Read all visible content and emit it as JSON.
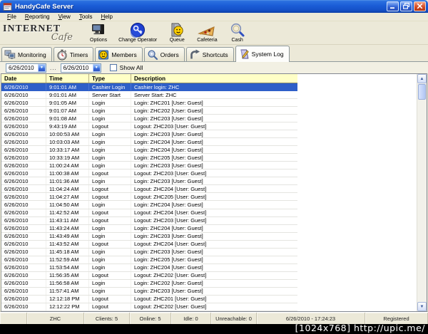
{
  "window": {
    "title": "HandyCafe Server",
    "app_icon": "app-icon",
    "controls": [
      {
        "name": "minimize-button",
        "icon": "minimize-icon"
      },
      {
        "name": "restore-button",
        "icon": "restore-icon"
      },
      {
        "name": "close-button",
        "icon": "close-icon"
      }
    ]
  },
  "menu": {
    "items": [
      "File",
      "Reporting",
      "View",
      "Tools",
      "Help"
    ]
  },
  "toolbar": {
    "logo": {
      "line1": "INTERNET",
      "line2": "Cafe"
    },
    "buttons": [
      {
        "label": "Options",
        "icon": "options-icon"
      },
      {
        "label": "Change Operator",
        "icon": "change-operator-icon"
      },
      {
        "label": "Queue",
        "icon": "queue-icon"
      },
      {
        "label": "Cafeteria",
        "icon": "cafeteria-icon"
      },
      {
        "label": "Cash",
        "icon": "cash-icon"
      }
    ]
  },
  "tabs": [
    {
      "label": "Monitoring",
      "icon": "monitoring-icon",
      "active": false
    },
    {
      "label": "Timers",
      "icon": "timers-icon",
      "active": false
    },
    {
      "label": "Members",
      "icon": "members-icon",
      "active": false
    },
    {
      "label": "Orders",
      "icon": "orders-icon",
      "active": false
    },
    {
      "label": "Shortcuts",
      "icon": "shortcuts-icon",
      "active": false
    },
    {
      "label": "System Log",
      "icon": "system-log-icon",
      "active": true
    }
  ],
  "filters": {
    "date_from": "6/26/2010",
    "range_separator": "...",
    "date_to": "6/26/2010",
    "show_all_label": "Show All",
    "show_all_checked": false
  },
  "log_table": {
    "columns": [
      "Date",
      "Time",
      "Type",
      "Description"
    ],
    "selected_row_index": 0,
    "rows": [
      [
        "6/26/2010",
        "9:01:01 AM",
        "Cashier Login",
        "Cashier login: ZHC"
      ],
      [
        "6/26/2010",
        "9:01:01 AM",
        "Server Start",
        "Server Start: ZHC"
      ],
      [
        "6/26/2010",
        "9:01:05 AM",
        "Login",
        "Login: ZHC201 [User: Guest]"
      ],
      [
        "6/26/2010",
        "9:01:07 AM",
        "Login",
        "Login: ZHC202 [User: Guest]"
      ],
      [
        "6/26/2010",
        "9:01:08 AM",
        "Login",
        "Login: ZHC203 [User: Guest]"
      ],
      [
        "6/26/2010",
        "9:43:19 AM",
        "Logout",
        "Logout: ZHC203 [User: Guest]"
      ],
      [
        "6/26/2010",
        "10:00:53 AM",
        "Login",
        "Login: ZHC203 [User: Guest]"
      ],
      [
        "6/26/2010",
        "10:03:03 AM",
        "Login",
        "Login: ZHC204 [User: Guest]"
      ],
      [
        "6/26/2010",
        "10:33:17 AM",
        "Login",
        "Login: ZHC204 [User: Guest]"
      ],
      [
        "6/26/2010",
        "10:33:19 AM",
        "Login",
        "Login: ZHC205 [User: Guest]"
      ],
      [
        "6/26/2010",
        "11:00:24 AM",
        "Login",
        "Login: ZHC203 [User: Guest]"
      ],
      [
        "6/26/2010",
        "11:00:38 AM",
        "Logout",
        "Logout: ZHC203 [User: Guest]"
      ],
      [
        "6/26/2010",
        "11:01:36 AM",
        "Login",
        "Login: ZHC203 [User: Guest]"
      ],
      [
        "6/26/2010",
        "11:04:24 AM",
        "Logout",
        "Logout: ZHC204 [User: Guest]"
      ],
      [
        "6/26/2010",
        "11:04:27 AM",
        "Logout",
        "Logout: ZHC205 [User: Guest]"
      ],
      [
        "6/26/2010",
        "11:04:50 AM",
        "Login",
        "Login: ZHC204 [User: Guest]"
      ],
      [
        "6/26/2010",
        "11:42:52 AM",
        "Logout",
        "Logout: ZHC204 [User: Guest]"
      ],
      [
        "6/26/2010",
        "11:43:11 AM",
        "Logout",
        "Logout: ZHC203 [User: Guest]"
      ],
      [
        "6/26/2010",
        "11:43:24 AM",
        "Login",
        "Login: ZHC204 [User: Guest]"
      ],
      [
        "6/26/2010",
        "11:43:49 AM",
        "Login",
        "Login: ZHC203 [User: Guest]"
      ],
      [
        "6/26/2010",
        "11:43:52 AM",
        "Logout",
        "Logout: ZHC204 [User: Guest]"
      ],
      [
        "6/26/2010",
        "11:45:18 AM",
        "Login",
        "Login: ZHC203 [User: Guest]"
      ],
      [
        "6/26/2010",
        "11:52:59 AM",
        "Login",
        "Login: ZHC205 [User: Guest]"
      ],
      [
        "6/26/2010",
        "11:53:54 AM",
        "Login",
        "Login: ZHC204 [User: Guest]"
      ],
      [
        "6/26/2010",
        "11:56:35 AM",
        "Logout",
        "Logout: ZHC202 [User: Guest]"
      ],
      [
        "6/26/2010",
        "11:56:58 AM",
        "Login",
        "Login: ZHC202 [User: Guest]"
      ],
      [
        "6/26/2010",
        "11:57:41 AM",
        "Login",
        "Login: ZHC203 [User: Guest]"
      ],
      [
        "6/26/2010",
        "12:12:18 PM",
        "Logout",
        "Logout: ZHC201 [User: Guest]"
      ],
      [
        "6/26/2010",
        "12:12:22 PM",
        "Logout",
        "Logout: ZHC202 [User: Guest]"
      ]
    ]
  },
  "status_bar": {
    "panels": [
      "",
      "ZHC",
      "Clients: 5",
      "Online: 5",
      "Idle: 0",
      "Unreachable: 0",
      "6/26/2010 - 17:24:23",
      "Registered"
    ]
  },
  "watermark": "[1024x768] http://upic.me/",
  "colors": {
    "titlebar_blue": "#1b5cd6",
    "selection_blue": "#2e5fc8",
    "header_yellow": "#ffffc6",
    "chrome_beige": "#ece9d8",
    "close_red": "#d04824"
  }
}
